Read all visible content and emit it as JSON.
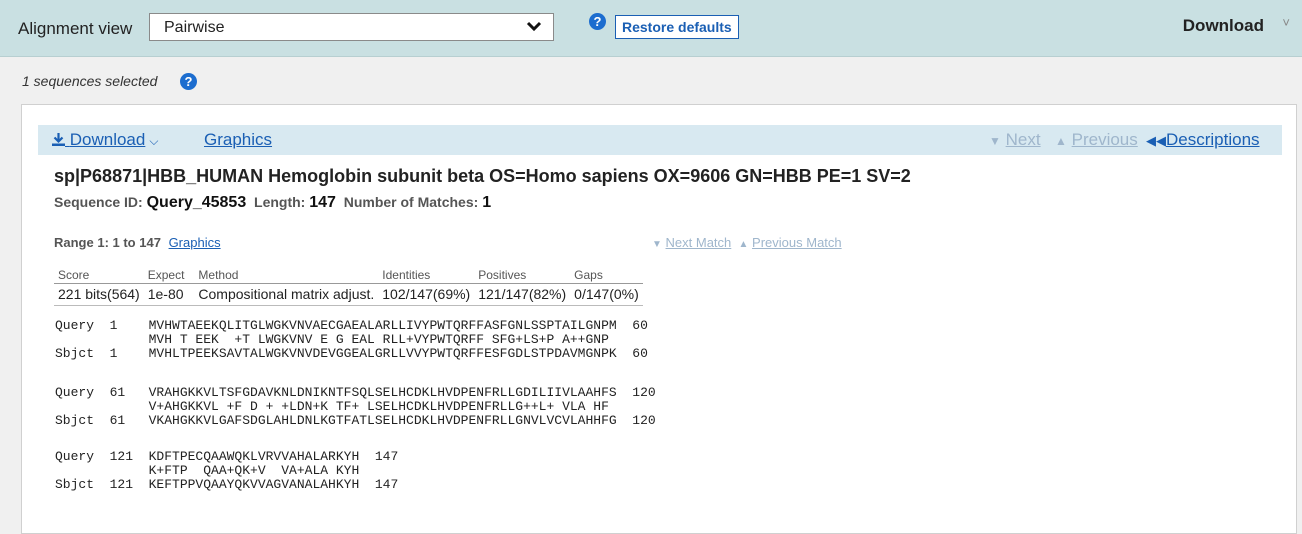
{
  "toolbar": {
    "alignment_view_label": "Alignment view",
    "alignment_view_value": "Pairwise",
    "help_icon": "question-circle-icon",
    "restore_defaults": "Restore defaults",
    "download": "Download",
    "download_chevron": "˅"
  },
  "selection": {
    "text": "1 sequences selected",
    "help_icon": "question-circle-icon"
  },
  "panel": {
    "download": "Download",
    "graphics": "Graphics",
    "next": "Next",
    "previous": "Previous",
    "descriptions": "Descriptions"
  },
  "hit": {
    "title": "sp|P68871|HBB_HUMAN Hemoglobin subunit beta OS=Homo sapiens OX=9606 GN=HBB PE=1 SV=2",
    "seq_id_label": "Sequence ID:",
    "seq_id": "Query_45853",
    "length_label": "Length:",
    "length": "147",
    "matches_label": "Number of Matches:",
    "matches": "1"
  },
  "range": {
    "label": "Range 1: 1 to 147",
    "graphics": "Graphics",
    "next_match": "Next Match",
    "previous_match": "Previous Match"
  },
  "score_table": {
    "headers": [
      "Score",
      "Expect",
      "Method",
      "Identities",
      "Positives",
      "Gaps"
    ],
    "values": [
      "221 bits(564)",
      "1e-80",
      "Compositional matrix adjust.",
      "102/147(69%)",
      "121/147(82%)",
      "0/147(0%)"
    ]
  },
  "alignment_blocks": [
    [
      "Query  1    MVHWTAEEKQLITGLWGKVNVAECGAEALARLLIVYPWTQRFFASFGNLSSPTAILGNPM  60",
      "            MVH T EEK  +T LWGKVNV E G EAL RLL+VYPWTQRFF SFG+LS+P A++GNP",
      "Sbjct  1    MVHLTPEEKSAVTALWGKVNVDEVGGEALGRLLVVYPWTQRFFESFGDLSTPDAVMGNPK  60"
    ],
    [
      "Query  61   VRAHGKKVLTSFGDAVKNLDNIKNTFSQLSELHCDKLHVDPENFRLLGDILIIVLAAHFS  120",
      "            V+AHGKKVL +F D + +LDN+K TF+ LSELHCDKLHVDPENFRLLG++L+ VLA HF",
      "Sbjct  61   VKAHGKKVLGAFSDGLAHLDNLKGTFATLSELHCDKLHVDPENFRLLGNVLVCVLAHHFG  120"
    ],
    [
      "Query  121  KDFTPECQAAWQKLVRVVAHALARKYH  147",
      "            K+FTP  QAA+QK+V  VA+ALA KYH",
      "Sbjct  121  KEFTPPVQAAYQKVVAGVANALAHKYH  147"
    ]
  ]
}
